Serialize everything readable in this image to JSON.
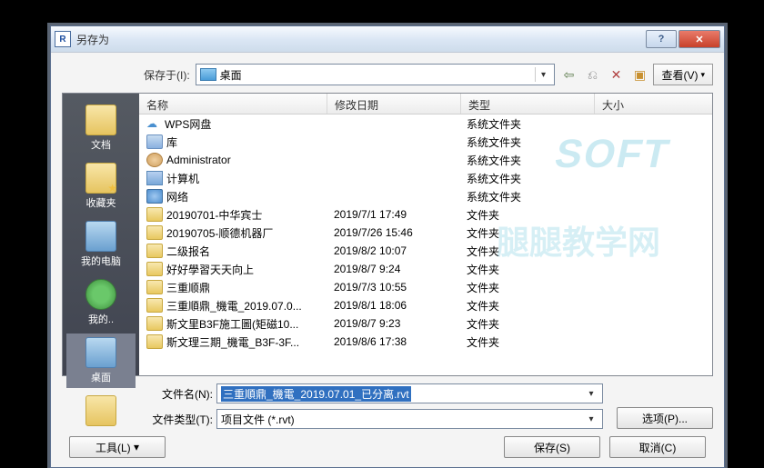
{
  "window": {
    "title": "另存为",
    "icon_letter": "R"
  },
  "location": {
    "label": "保存于(I):",
    "value": "桌面"
  },
  "toolbar": {
    "view_label": "查看(V)"
  },
  "columns": {
    "name": "名称",
    "modified": "修改日期",
    "type": "类型",
    "size": "大小"
  },
  "sidebar": {
    "items": [
      {
        "label": "文档",
        "icon": "folder"
      },
      {
        "label": "收藏夹",
        "icon": "star"
      },
      {
        "label": "我的电脑",
        "icon": "computer"
      },
      {
        "label": "我的..",
        "icon": "globe"
      },
      {
        "label": "桌面",
        "icon": "computer",
        "selected": true
      },
      {
        "label": "",
        "icon": "folder"
      }
    ]
  },
  "files": [
    {
      "icon": "cloud",
      "name": "WPS网盘",
      "modified": "",
      "type": "系统文件夹"
    },
    {
      "icon": "lib",
      "name": "库",
      "modified": "",
      "type": "系统文件夹"
    },
    {
      "icon": "user",
      "name": "Administrator",
      "modified": "",
      "type": "系统文件夹"
    },
    {
      "icon": "pc",
      "name": "计算机",
      "modified": "",
      "type": "系统文件夹"
    },
    {
      "icon": "net",
      "name": "网络",
      "modified": "",
      "type": "系统文件夹"
    },
    {
      "icon": "folder",
      "name": "20190701-中华宾士",
      "modified": "2019/7/1 17:49",
      "type": "文件夹"
    },
    {
      "icon": "folder",
      "name": "20190705-顺德机器厂",
      "modified": "2019/7/26 15:46",
      "type": "文件夹"
    },
    {
      "icon": "folder",
      "name": "二级报名",
      "modified": "2019/8/2 10:07",
      "type": "文件夹"
    },
    {
      "icon": "folder",
      "name": "好好學習天天向上",
      "modified": "2019/8/7 9:24",
      "type": "文件夹"
    },
    {
      "icon": "folder",
      "name": "三重顺鼎",
      "modified": "2019/7/3 10:55",
      "type": "文件夹"
    },
    {
      "icon": "folder",
      "name": "三重順鼎_機電_2019.07.0...",
      "modified": "2019/8/1 18:06",
      "type": "文件夹"
    },
    {
      "icon": "folder",
      "name": "斯文里B3F施工圖(矩磁10...",
      "modified": "2019/8/7 9:23",
      "type": "文件夹"
    },
    {
      "icon": "folder",
      "name": "斯文理三期_機電_B3F-3F...",
      "modified": "2019/8/6 17:38",
      "type": "文件夹"
    }
  ],
  "fields": {
    "filename_label": "文件名(N):",
    "filename_value": "三重順鼎_機電_2019.07.01_已分离.rvt",
    "filetype_label": "文件类型(T):",
    "filetype_value": "项目文件 (*.rvt)"
  },
  "buttons": {
    "tools": "工具(L)",
    "options": "选项(P)...",
    "save": "保存(S)",
    "cancel": "取消(C)"
  },
  "watermark": {
    "line1": "SOFT",
    "line2": "腿腿教学网"
  }
}
